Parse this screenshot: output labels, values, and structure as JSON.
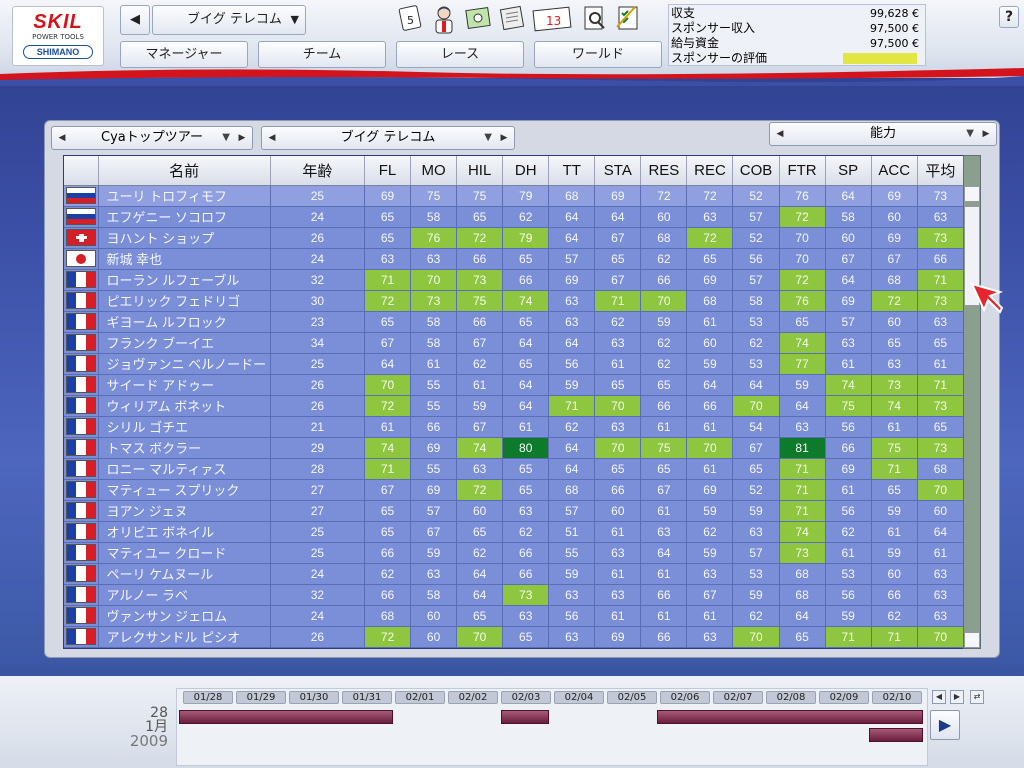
{
  "topbar": {
    "logo_top": "SKIL",
    "logo_sub": "POWER TOOLS",
    "logo_bottom": "SHIMANO",
    "team_name": "ブイグ テレコム",
    "nav_tabs": [
      "マネージャー",
      "チーム",
      "レース",
      "ワールド"
    ],
    "icons": [
      "calendar-5-icon",
      "cyclist-icon",
      "bank-note-icon",
      "newspaper-icon",
      "calendar-13-icon",
      "search-doc-icon",
      "checklist-icon"
    ],
    "icon_calendar_day": "5",
    "icon_mail_day": "13",
    "help_label": "?"
  },
  "finance": {
    "balance_label": "収支",
    "balance_value": "99,628 €",
    "sponsor_income_label": "スポンサー収入",
    "sponsor_income_value": "97,500 €",
    "salary_budget_label": "給与資金",
    "salary_budget_value": "97,500 €",
    "sponsor_rating_label": "スポンサーの評価"
  },
  "panel": {
    "race_select": "Cyaトップツアー",
    "team_select": "ブイグ テレコム",
    "view_select": "能力"
  },
  "table": {
    "columns": [
      "名前",
      "年齢",
      "FL",
      "MO",
      "HIL",
      "DH",
      "TT",
      "STA",
      "RES",
      "REC",
      "COB",
      "FTR",
      "SP",
      "ACC",
      "平均"
    ],
    "rows": [
      {
        "flag": "ru",
        "name": "ユーリ トロフィモフ",
        "age": "25",
        "s": [
          "69",
          "75",
          "75",
          "79",
          "68",
          "69",
          "72",
          "72",
          "52",
          "76",
          "64",
          "69",
          "73"
        ],
        "hl": [
          0,
          1,
          1,
          1,
          0,
          0,
          1,
          1,
          0,
          1,
          0,
          0,
          1
        ],
        "selected": true
      },
      {
        "flag": "ru",
        "name": "エフゲニー ソコロフ",
        "age": "24",
        "s": [
          "65",
          "58",
          "65",
          "62",
          "64",
          "64",
          "60",
          "63",
          "57",
          "72",
          "58",
          "60",
          "63"
        ],
        "hl": [
          0,
          0,
          0,
          0,
          0,
          0,
          0,
          0,
          0,
          1,
          0,
          0,
          0
        ]
      },
      {
        "flag": "ch",
        "name": "ヨハント ショップ",
        "age": "26",
        "s": [
          "65",
          "76",
          "72",
          "79",
          "64",
          "67",
          "68",
          "72",
          "52",
          "70",
          "60",
          "69",
          "73"
        ],
        "hl": [
          0,
          1,
          1,
          1,
          0,
          0,
          0,
          1,
          0,
          0,
          0,
          0,
          1
        ]
      },
      {
        "flag": "jp",
        "name": "新城 幸也",
        "age": "24",
        "s": [
          "63",
          "63",
          "66",
          "65",
          "57",
          "65",
          "62",
          "65",
          "56",
          "70",
          "67",
          "67",
          "66"
        ],
        "hl": [
          0,
          0,
          0,
          0,
          0,
          0,
          0,
          0,
          0,
          0,
          0,
          0,
          0
        ]
      },
      {
        "flag": "fr",
        "name": "ローラン ルフェーブル",
        "age": "32",
        "s": [
          "71",
          "70",
          "73",
          "66",
          "69",
          "67",
          "66",
          "69",
          "57",
          "72",
          "64",
          "68",
          "71"
        ],
        "hl": [
          1,
          1,
          1,
          0,
          0,
          0,
          0,
          0,
          0,
          1,
          0,
          0,
          1
        ]
      },
      {
        "flag": "fr",
        "name": "ピエリック フェドリゴ",
        "age": "30",
        "s": [
          "72",
          "73",
          "75",
          "74",
          "63",
          "71",
          "70",
          "68",
          "58",
          "76",
          "69",
          "72",
          "73"
        ],
        "hl": [
          1,
          1,
          1,
          1,
          0,
          1,
          1,
          0,
          0,
          1,
          0,
          1,
          1
        ]
      },
      {
        "flag": "fr",
        "name": "ギヨーム ルフロック",
        "age": "23",
        "s": [
          "65",
          "58",
          "66",
          "65",
          "63",
          "62",
          "59",
          "61",
          "53",
          "65",
          "57",
          "60",
          "63"
        ],
        "hl": [
          0,
          0,
          0,
          0,
          0,
          0,
          0,
          0,
          0,
          0,
          0,
          0,
          0
        ]
      },
      {
        "flag": "fr",
        "name": "フランク ブーイエ",
        "age": "34",
        "s": [
          "67",
          "58",
          "67",
          "64",
          "64",
          "63",
          "62",
          "60",
          "62",
          "74",
          "63",
          "65",
          "65"
        ],
        "hl": [
          0,
          0,
          0,
          0,
          0,
          0,
          0,
          0,
          0,
          1,
          0,
          0,
          0
        ]
      },
      {
        "flag": "fr",
        "name": "ジョヴァンニ ベルノードー",
        "age": "25",
        "s": [
          "64",
          "61",
          "62",
          "65",
          "56",
          "61",
          "62",
          "59",
          "53",
          "77",
          "61",
          "63",
          "61"
        ],
        "hl": [
          0,
          0,
          0,
          0,
          0,
          0,
          0,
          0,
          0,
          1,
          0,
          0,
          0
        ]
      },
      {
        "flag": "fr",
        "name": "サイード アドゥー",
        "age": "26",
        "s": [
          "70",
          "55",
          "61",
          "64",
          "59",
          "65",
          "65",
          "64",
          "64",
          "59",
          "74",
          "73",
          "71"
        ],
        "hl": [
          1,
          0,
          0,
          0,
          0,
          0,
          0,
          0,
          0,
          0,
          1,
          1,
          1
        ]
      },
      {
        "flag": "fr",
        "name": "ウィリアム ボネット",
        "age": "26",
        "s": [
          "72",
          "55",
          "59",
          "64",
          "71",
          "70",
          "66",
          "66",
          "70",
          "64",
          "75",
          "74",
          "73"
        ],
        "hl": [
          1,
          0,
          0,
          0,
          1,
          1,
          0,
          0,
          1,
          0,
          1,
          1,
          1
        ]
      },
      {
        "flag": "fr",
        "name": "シリル ゴチエ",
        "age": "21",
        "s": [
          "61",
          "66",
          "67",
          "61",
          "62",
          "63",
          "61",
          "61",
          "54",
          "63",
          "56",
          "61",
          "65"
        ],
        "hl": [
          0,
          0,
          0,
          0,
          0,
          0,
          0,
          0,
          0,
          0,
          0,
          0,
          0
        ]
      },
      {
        "flag": "fr",
        "name": "トマス ボクラー",
        "age": "29",
        "s": [
          "74",
          "69",
          "74",
          "80",
          "64",
          "70",
          "75",
          "70",
          "67",
          "81",
          "66",
          "75",
          "73"
        ],
        "hl": [
          1,
          0,
          1,
          2,
          0,
          1,
          1,
          1,
          0,
          2,
          0,
          1,
          1
        ]
      },
      {
        "flag": "fr",
        "name": "ロニー マルティァス",
        "age": "28",
        "s": [
          "71",
          "55",
          "63",
          "65",
          "64",
          "65",
          "65",
          "61",
          "65",
          "71",
          "69",
          "71",
          "68"
        ],
        "hl": [
          1,
          0,
          0,
          0,
          0,
          0,
          0,
          0,
          0,
          1,
          0,
          1,
          0
        ]
      },
      {
        "flag": "fr",
        "name": "マティュー スプリック",
        "age": "27",
        "s": [
          "67",
          "69",
          "72",
          "65",
          "68",
          "66",
          "67",
          "69",
          "52",
          "71",
          "61",
          "65",
          "70"
        ],
        "hl": [
          0,
          0,
          1,
          0,
          0,
          0,
          0,
          0,
          0,
          1,
          0,
          0,
          1
        ]
      },
      {
        "flag": "fr",
        "name": "ヨアン ジェヌ",
        "age": "27",
        "s": [
          "65",
          "57",
          "60",
          "63",
          "57",
          "60",
          "61",
          "59",
          "59",
          "71",
          "56",
          "59",
          "60"
        ],
        "hl": [
          0,
          0,
          0,
          0,
          0,
          0,
          0,
          0,
          0,
          1,
          0,
          0,
          0
        ]
      },
      {
        "flag": "fr",
        "name": "オリビエ ボネイル",
        "age": "25",
        "s": [
          "65",
          "67",
          "65",
          "62",
          "51",
          "61",
          "63",
          "62",
          "63",
          "74",
          "62",
          "61",
          "64"
        ],
        "hl": [
          0,
          0,
          0,
          0,
          0,
          0,
          0,
          0,
          0,
          1,
          0,
          0,
          0
        ]
      },
      {
        "flag": "fr",
        "name": "マティユー クロード",
        "age": "25",
        "s": [
          "66",
          "59",
          "62",
          "66",
          "55",
          "63",
          "64",
          "59",
          "57",
          "73",
          "61",
          "59",
          "61"
        ],
        "hl": [
          0,
          0,
          0,
          0,
          0,
          0,
          0,
          0,
          0,
          1,
          0,
          0,
          0
        ]
      },
      {
        "flag": "fr",
        "name": "ペーリ ケムヌール",
        "age": "24",
        "s": [
          "62",
          "63",
          "64",
          "66",
          "59",
          "61",
          "61",
          "63",
          "53",
          "68",
          "53",
          "60",
          "63"
        ],
        "hl": [
          0,
          0,
          0,
          0,
          0,
          0,
          0,
          0,
          0,
          0,
          0,
          0,
          0
        ]
      },
      {
        "flag": "fr",
        "name": "アルノー ラベ",
        "age": "32",
        "s": [
          "66",
          "58",
          "64",
          "73",
          "63",
          "63",
          "66",
          "67",
          "59",
          "68",
          "56",
          "66",
          "63"
        ],
        "hl": [
          0,
          0,
          0,
          1,
          0,
          0,
          0,
          0,
          0,
          0,
          0,
          0,
          0
        ]
      },
      {
        "flag": "fr",
        "name": "ヴァンサン ジェロム",
        "age": "24",
        "s": [
          "68",
          "60",
          "65",
          "63",
          "56",
          "61",
          "61",
          "61",
          "62",
          "64",
          "59",
          "62",
          "63"
        ],
        "hl": [
          0,
          0,
          0,
          0,
          0,
          0,
          0,
          0,
          0,
          0,
          0,
          0,
          0
        ]
      },
      {
        "flag": "fr",
        "name": "アレクサンドル ピシオ",
        "age": "26",
        "s": [
          "72",
          "60",
          "70",
          "65",
          "63",
          "69",
          "66",
          "63",
          "70",
          "65",
          "71",
          "71",
          "70"
        ],
        "hl": [
          1,
          0,
          1,
          0,
          0,
          0,
          0,
          0,
          1,
          0,
          1,
          1,
          1
        ]
      }
    ]
  },
  "calendar": {
    "day": "28",
    "month": "1月",
    "year": "2009",
    "dates": [
      "01/28",
      "01/29",
      "01/30",
      "01/31",
      "02/01",
      "02/02",
      "02/03",
      "02/04",
      "02/05",
      "02/06",
      "02/07",
      "02/08",
      "02/09",
      "02/10"
    ]
  },
  "colors": {
    "accent_red": "#d4141d",
    "highlight_green": "#8ec63f",
    "top_green": "#0e7a2b",
    "row_blue": "#7b8ed8",
    "race_bar": "#7a2a48",
    "rating_yellow": "#e2e642"
  }
}
